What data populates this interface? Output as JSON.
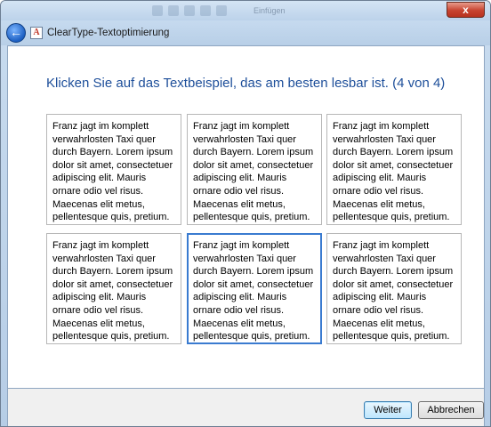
{
  "window": {
    "title": "ClearType-Textoptimierung",
    "close_label": "x",
    "app_icon_glyph": "A"
  },
  "ghost": {
    "text": "Einfügen"
  },
  "instruction": "Klicken Sie auf das Textbeispiel, das am besten lesbar ist. (4 von 4)",
  "samples": [
    {
      "text": "Franz jagt im komplett verwahrlosten Taxi quer durch Bayern. Lorem ipsum dolor sit amet, consectetuer adipiscing elit. Mauris ornare odio vel risus. Maecenas elit metus, pellentesque quis, pretium."
    },
    {
      "text": "Franz jagt im komplett verwahrlosten Taxi quer durch Bayern. Lorem ipsum dolor sit amet, consectetuer adipiscing elit. Mauris ornare odio vel risus. Maecenas elit metus, pellentesque quis, pretium."
    },
    {
      "text": "Franz jagt im komplett verwahrlosten Taxi quer durch Bayern. Lorem ipsum dolor sit amet, consectetuer adipiscing elit. Mauris ornare odio vel risus. Maecenas elit metus, pellentesque quis, pretium."
    },
    {
      "text": "Franz jagt im komplett verwahrlosten Taxi quer durch Bayern. Lorem ipsum dolor sit amet, consectetuer adipiscing elit. Mauris ornare odio vel risus. Maecenas elit metus, pellentesque quis, pretium."
    },
    {
      "text": "Franz jagt im komplett verwahrlosten Taxi quer durch Bayern. Lorem ipsum dolor sit amet, consectetuer adipiscing elit. Mauris ornare odio vel risus. Maecenas elit metus, pellentesque quis, pretium."
    },
    {
      "text": "Franz jagt im komplett verwahrlosten Taxi quer durch Bayern. Lorem ipsum dolor sit amet, consectetuer adipiscing elit. Mauris ornare odio vel risus. Maecenas elit metus, pellentesque quis, pretium."
    }
  ],
  "selected_sample": 5,
  "buttons": {
    "next": "Weiter",
    "cancel": "Abbrechen"
  },
  "colors": {
    "accent": "#1e4f9a",
    "selection": "#3a7bd0",
    "close": "#c7432f"
  }
}
